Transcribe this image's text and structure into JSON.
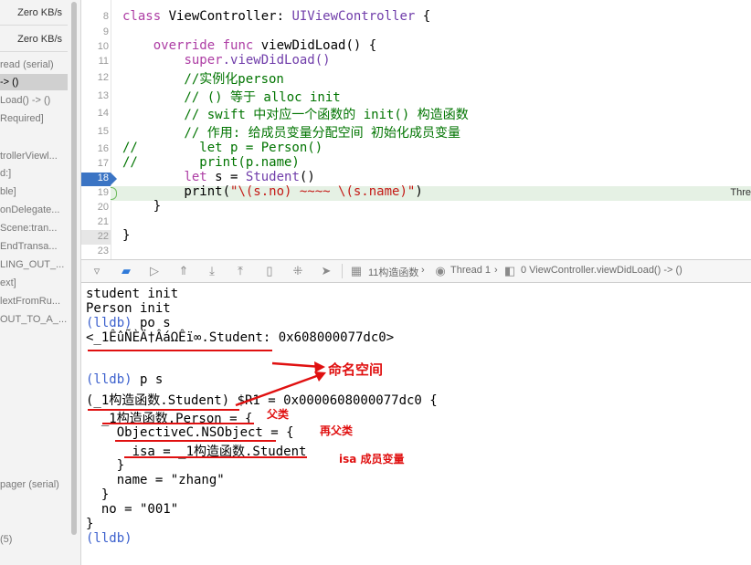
{
  "navigator": {
    "rows": [
      {
        "text": "Zero KB/s"
      },
      {
        "text": "Zero KB/s"
      },
      {
        "text": "read (serial)"
      },
      {
        "text": "-> ()"
      },
      {
        "text": "Load() -> ()"
      },
      {
        "text": "Required]"
      },
      {
        "text": "trollerViewl..."
      },
      {
        "text": "d:]"
      },
      {
        "text": "ble]"
      },
      {
        "text": "onDelegate..."
      },
      {
        "text": "Scene:tran..."
      },
      {
        "text": "EndTransa..."
      },
      {
        "text": "LING_OUT_..."
      },
      {
        "text": "ext]"
      },
      {
        "text": "lextFromRu..."
      },
      {
        "text": "OUT_TO_A_..."
      },
      {
        "text": "pager (serial)"
      },
      {
        "text": "(5)"
      }
    ]
  },
  "editor": {
    "line_numbers": [
      "8",
      "9",
      "10",
      "11",
      "12",
      "13",
      "14",
      "15",
      "16",
      "17",
      "18",
      "19",
      "20",
      "21",
      "22",
      "23"
    ],
    "thread_tag": "Thre",
    "lines": {
      "l8": [
        "class ",
        "ViewController",
        ": ",
        "UIViewController",
        " {"
      ],
      "l10": [
        "    ",
        "override",
        " ",
        "func",
        " viewDidLoad() {"
      ],
      "l11": [
        "        ",
        "super",
        ".viewDidLoad()"
      ],
      "l12": "        //实例化person",
      "l13": "        // () 等于 alloc init",
      "l14": "        // swift 中对应一个函数的 init() 构造函数",
      "l15": "        // 作用: 给成员变量分配空间 初始化成员变量",
      "l16": "//        let p = Person()",
      "l17": "//        print(p.name)",
      "l18": [
        "        ",
        "let",
        " s = ",
        "Student",
        "()"
      ],
      "l19": [
        "        print(",
        "\"\\(s.no) ~~~~ \\(s.name)\"",
        ")"
      ],
      "l20": "    }",
      "l22": "}"
    }
  },
  "debug_bar": {
    "func_label": "11构造函数",
    "thread_label": "Thread 1",
    "frame_label": "0 ViewController.viewDidLoad() -> ()"
  },
  "console": {
    "lines": [
      {
        "prompt": "",
        "text": "student init"
      },
      {
        "prompt": "",
        "text": "Person init"
      },
      {
        "prompt": "(lldb)",
        "text": " po s"
      },
      {
        "prompt": "",
        "text": "<_1ÊûÑÈÄ†ÂáΩÊï∞.Student: 0x608000077dc0>"
      },
      {
        "prompt": "",
        "text": ""
      },
      {
        "prompt": "(lldb)",
        "text": " p s"
      },
      {
        "prompt": "",
        "text": "(_1构造函数.Student) $R1 = 0x0000608000077dc0 {"
      },
      {
        "prompt": "",
        "text": "  _1构造函数.Person = {"
      },
      {
        "prompt": "",
        "text": "    ObjectiveC.NSObject = {"
      },
      {
        "prompt": "",
        "text": "      isa = _1构造函数.Student"
      },
      {
        "prompt": "",
        "text": "    }"
      },
      {
        "prompt": "",
        "text": "    name = \"zhang\""
      },
      {
        "prompt": "",
        "text": "  }"
      },
      {
        "prompt": "",
        "text": "  no = \"001\""
      },
      {
        "prompt": "",
        "text": "}"
      },
      {
        "prompt": "(lldb)",
        "text": ""
      }
    ]
  },
  "annotations": {
    "namespace": "命名空间",
    "parent": "父类",
    "grandparent": "再父类",
    "isa": "isa 成员变量",
    "color": "#e01010"
  },
  "colors": {
    "keyword": "#ad3da4",
    "type": "#703daa",
    "comment": "#007400",
    "string": "#c41a16",
    "breakpoint": "#3b74c4",
    "lldb_prompt": "#3a5fcd"
  }
}
